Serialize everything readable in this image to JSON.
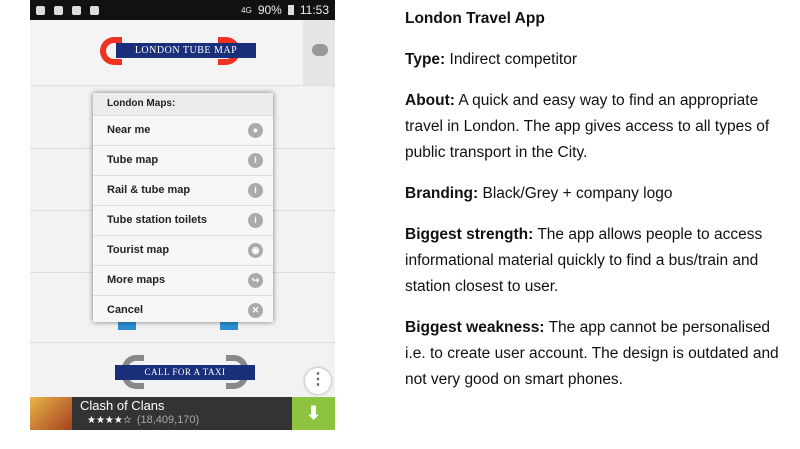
{
  "phone": {
    "status": {
      "battery": "90%",
      "time": "11:53",
      "network": "4G"
    },
    "header_logo": "LONDON TUBE MAP",
    "popup": {
      "title": "London Maps:",
      "items": [
        {
          "label": "Near me",
          "icon": "location-pin-icon"
        },
        {
          "label": "Tube map",
          "icon": "info-icon"
        },
        {
          "label": "Rail & tube map",
          "icon": "info-icon"
        },
        {
          "label": "Tube station toilets",
          "icon": "info-icon"
        },
        {
          "label": "Tourist map",
          "icon": "eye-icon"
        },
        {
          "label": "More maps",
          "icon": "share-icon"
        },
        {
          "label": "Cancel",
          "icon": "close-icon"
        }
      ]
    },
    "taxi_logo": "CALL FOR A TAXI",
    "ad": {
      "title": "Clash of Clans",
      "stars": "★★★★☆",
      "count": "(18,409,170)"
    }
  },
  "notes": {
    "title": "London Travel App",
    "type_label": "Type:",
    "type_value": " Indirect competitor",
    "about_label": "About:",
    "about_value": " A quick and easy way to find an appropriate travel in London. The app gives access to all types of public transport in the City.",
    "branding_label": "Branding:",
    "branding_value": " Black/Grey + company logo",
    "strength_label": "Biggest strength:",
    "strength_value": " The app allows people to access informational material quickly to find a bus/train and station closest to user.",
    "weakness_label": "Biggest weakness:",
    "weakness_value": " The app cannot be personalised i.e. to create user account.  The design is outdated and not very good on smart phones."
  }
}
